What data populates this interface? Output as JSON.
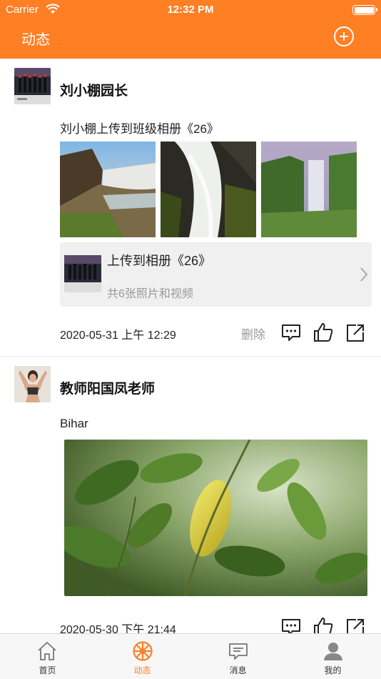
{
  "status_bar": {
    "carrier": "Carrier",
    "time": "12:32 PM"
  },
  "nav": {
    "title": "动态"
  },
  "posts": [
    {
      "author": "刘小棚园长",
      "text": "刘小棚上传到班级相册《26》",
      "album": {
        "title": "上传到相册《26》",
        "subtitle": "共6张照片和视频"
      },
      "date": "2020-05-31 上午 12:29",
      "delete_label": "删除"
    },
    {
      "author": "教师阳国凤老师",
      "text": "Bihar",
      "date": "2020-05-30 下午 21:44"
    }
  ],
  "tabs": [
    {
      "label": "首页",
      "icon": "home-icon"
    },
    {
      "label": "动态",
      "icon": "wheel-icon"
    },
    {
      "label": "消息",
      "icon": "message-icon"
    },
    {
      "label": "我的",
      "icon": "person-icon"
    }
  ],
  "colors": {
    "accent": "#FF7F24"
  }
}
